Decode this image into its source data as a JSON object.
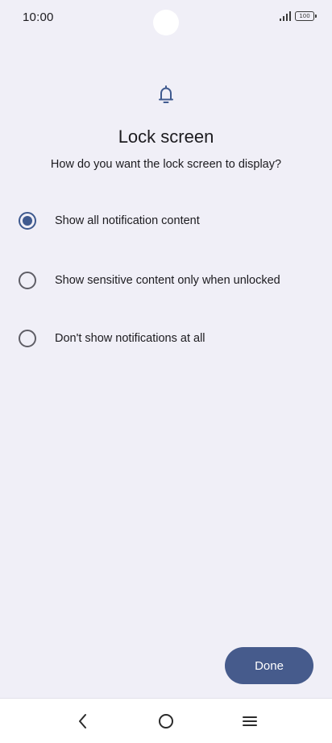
{
  "status_bar": {
    "time": "10:00",
    "battery": "100",
    "signal_icon": "signal-bars-icon"
  },
  "header": {
    "icon": "bell-icon",
    "title": "Lock screen",
    "subtitle": "How do you want the lock screen to display?"
  },
  "options": [
    {
      "label": "Show all notification content",
      "selected": true
    },
    {
      "label": "Show sensitive content only when unlocked",
      "selected": false
    },
    {
      "label": "Don't show notifications at all",
      "selected": false
    }
  ],
  "done_label": "Done",
  "nav": {
    "back_icon": "back-chevron-icon",
    "home_icon": "home-circle-icon",
    "recents_icon": "menu-lines-icon"
  },
  "colors": {
    "background": "#f0eff7",
    "accent": "#465b8c",
    "radio_selected": "#3f5a8f",
    "radio_unselected": "#5f5e66"
  }
}
